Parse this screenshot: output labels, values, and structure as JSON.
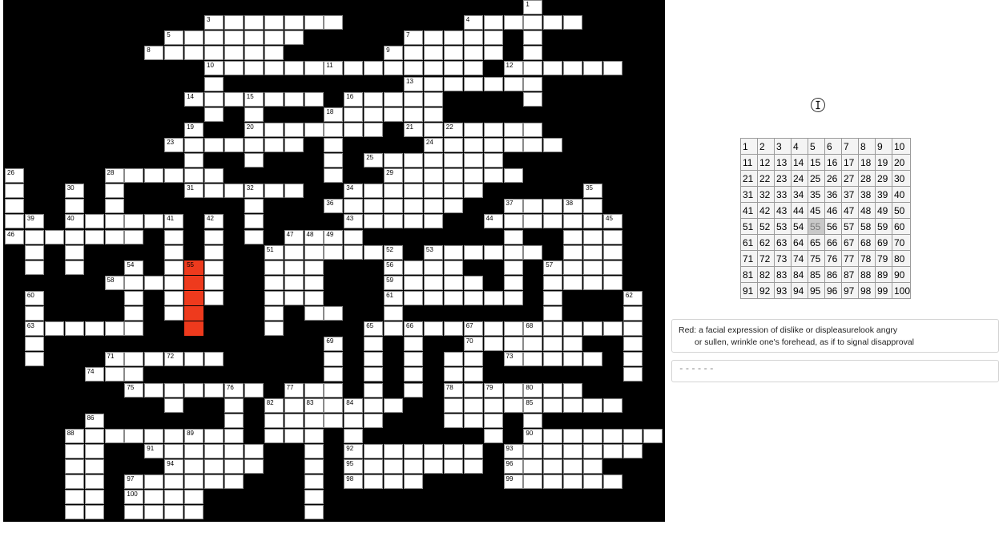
{
  "puzzle": {
    "highlight_color": "#ee3a1d",
    "active_clue": "55",
    "clue_prefix": "Red:",
    "clue_line1": "a facial expression of dislike or displeasurelook angry",
    "clue_line2": "or sullen, wrinkle one's forehead, as if to signal disapproval",
    "answer_value": "------",
    "cursor_icon": "text-cursor-icon"
  },
  "picker": {
    "numbers": [
      "1",
      "2",
      "3",
      "4",
      "5",
      "6",
      "7",
      "8",
      "9",
      "10",
      "11",
      "12",
      "13",
      "14",
      "15",
      "16",
      "17",
      "18",
      "19",
      "20",
      "21",
      "22",
      "23",
      "24",
      "25",
      "26",
      "27",
      "28",
      "29",
      "30",
      "31",
      "32",
      "33",
      "34",
      "35",
      "36",
      "37",
      "38",
      "39",
      "40",
      "41",
      "42",
      "43",
      "44",
      "45",
      "46",
      "47",
      "48",
      "49",
      "50",
      "51",
      "52",
      "53",
      "54",
      "55",
      "56",
      "57",
      "58",
      "59",
      "60",
      "61",
      "62",
      "63",
      "64",
      "65",
      "66",
      "67",
      "68",
      "69",
      "70",
      "71",
      "72",
      "73",
      "74",
      "75",
      "76",
      "77",
      "78",
      "79",
      "80",
      "81",
      "82",
      "83",
      "84",
      "85",
      "86",
      "87",
      "88",
      "89",
      "90",
      "91",
      "92",
      "93",
      "94",
      "95",
      "96",
      "97",
      "98",
      "99",
      "100"
    ],
    "selected": "55"
  },
  "grid_numbers": [
    {
      "n": "1",
      "c": 26,
      "r": 0
    },
    {
      "n": "3",
      "c": 10,
      "r": 1
    },
    {
      "n": "4",
      "c": 23,
      "r": 1
    },
    {
      "n": "5",
      "c": 8,
      "r": 2
    },
    {
      "n": "7",
      "c": 20,
      "r": 2
    },
    {
      "n": "8",
      "c": 7,
      "r": 3
    },
    {
      "n": "9",
      "c": 19,
      "r": 3
    },
    {
      "n": "10",
      "c": 10,
      "r": 4
    },
    {
      "n": "11",
      "c": 16,
      "r": 4
    },
    {
      "n": "12",
      "c": 25,
      "r": 4
    },
    {
      "n": "13",
      "c": 20,
      "r": 5
    },
    {
      "n": "14",
      "c": 9,
      "r": 6
    },
    {
      "n": "15",
      "c": 12,
      "r": 6
    },
    {
      "n": "16",
      "c": 17,
      "r": 6
    },
    {
      "n": "18",
      "c": 16,
      "r": 7
    },
    {
      "n": "19",
      "c": 9,
      "r": 8
    },
    {
      "n": "20",
      "c": 12,
      "r": 8
    },
    {
      "n": "21",
      "c": 20,
      "r": 8
    },
    {
      "n": "22",
      "c": 22,
      "r": 8
    },
    {
      "n": "23",
      "c": 8,
      "r": 9
    },
    {
      "n": "24",
      "c": 21,
      "r": 9
    },
    {
      "n": "25",
      "c": 18,
      "r": 10
    },
    {
      "n": "26",
      "c": 0,
      "r": 11
    },
    {
      "n": "28",
      "c": 5,
      "r": 11
    },
    {
      "n": "29",
      "c": 19,
      "r": 11
    },
    {
      "n": "30",
      "c": 3,
      "r": 12
    },
    {
      "n": "31",
      "c": 9,
      "r": 12
    },
    {
      "n": "32",
      "c": 12,
      "r": 12
    },
    {
      "n": "34",
      "c": 17,
      "r": 12
    },
    {
      "n": "35",
      "c": 29,
      "r": 12
    },
    {
      "n": "36",
      "c": 16,
      "r": 13
    },
    {
      "n": "37",
      "c": 25,
      "r": 13
    },
    {
      "n": "38",
      "c": 28,
      "r": 13
    },
    {
      "n": "39",
      "c": 1,
      "r": 14
    },
    {
      "n": "40",
      "c": 3,
      "r": 14
    },
    {
      "n": "41",
      "c": 8,
      "r": 14
    },
    {
      "n": "42",
      "c": 10,
      "r": 14
    },
    {
      "n": "43",
      "c": 17,
      "r": 14
    },
    {
      "n": "44",
      "c": 24,
      "r": 14
    },
    {
      "n": "45",
      "c": 30,
      "r": 14
    },
    {
      "n": "46",
      "c": 0,
      "r": 15
    },
    {
      "n": "47",
      "c": 14,
      "r": 15
    },
    {
      "n": "48",
      "c": 15,
      "r": 15
    },
    {
      "n": "49",
      "c": 16,
      "r": 15
    },
    {
      "n": "51",
      "c": 13,
      "r": 16
    },
    {
      "n": "52",
      "c": 19,
      "r": 16
    },
    {
      "n": "53",
      "c": 21,
      "r": 16
    },
    {
      "n": "54",
      "c": 6,
      "r": 17
    },
    {
      "n": "55",
      "c": 9,
      "r": 17
    },
    {
      "n": "56",
      "c": 19,
      "r": 17
    },
    {
      "n": "57",
      "c": 27,
      "r": 17
    },
    {
      "n": "58",
      "c": 5,
      "r": 18
    },
    {
      "n": "59",
      "c": 19,
      "r": 18
    },
    {
      "n": "60",
      "c": 1,
      "r": 19
    },
    {
      "n": "61",
      "c": 19,
      "r": 19
    },
    {
      "n": "62",
      "c": 31,
      "r": 19
    },
    {
      "n": "63",
      "c": 1,
      "r": 21
    },
    {
      "n": "65",
      "c": 18,
      "r": 21
    },
    {
      "n": "66",
      "c": 20,
      "r": 21
    },
    {
      "n": "67",
      "c": 23,
      "r": 21
    },
    {
      "n": "68",
      "c": 26,
      "r": 21
    },
    {
      "n": "69",
      "c": 16,
      "r": 22
    },
    {
      "n": "70",
      "c": 23,
      "r": 22
    },
    {
      "n": "71",
      "c": 5,
      "r": 23
    },
    {
      "n": "72",
      "c": 8,
      "r": 23
    },
    {
      "n": "73",
      "c": 25,
      "r": 23
    },
    {
      "n": "74",
      "c": 4,
      "r": 24
    },
    {
      "n": "75",
      "c": 6,
      "r": 25
    },
    {
      "n": "76",
      "c": 11,
      "r": 25
    },
    {
      "n": "77",
      "c": 14,
      "r": 25
    },
    {
      "n": "78",
      "c": 22,
      "r": 25
    },
    {
      "n": "79",
      "c": 24,
      "r": 25
    },
    {
      "n": "80",
      "c": 26,
      "r": 25
    },
    {
      "n": "82",
      "c": 13,
      "r": 26
    },
    {
      "n": "83",
      "c": 15,
      "r": 26
    },
    {
      "n": "84",
      "c": 17,
      "r": 26
    },
    {
      "n": "85",
      "c": 26,
      "r": 26
    },
    {
      "n": "86",
      "c": 4,
      "r": 27
    },
    {
      "n": "88",
      "c": 3,
      "r": 28
    },
    {
      "n": "89",
      "c": 9,
      "r": 28
    },
    {
      "n": "90",
      "c": 26,
      "r": 28
    },
    {
      "n": "91",
      "c": 7,
      "r": 29
    },
    {
      "n": "92",
      "c": 17,
      "r": 29
    },
    {
      "n": "93",
      "c": 25,
      "r": 29
    },
    {
      "n": "94",
      "c": 8,
      "r": 30
    },
    {
      "n": "95",
      "c": 17,
      "r": 30
    },
    {
      "n": "96",
      "c": 25,
      "r": 30
    },
    {
      "n": "97",
      "c": 6,
      "r": 31
    },
    {
      "n": "98",
      "c": 17,
      "r": 31
    },
    {
      "n": "99",
      "c": 25,
      "r": 31
    },
    {
      "n": "100",
      "c": 6,
      "r": 32
    }
  ]
}
